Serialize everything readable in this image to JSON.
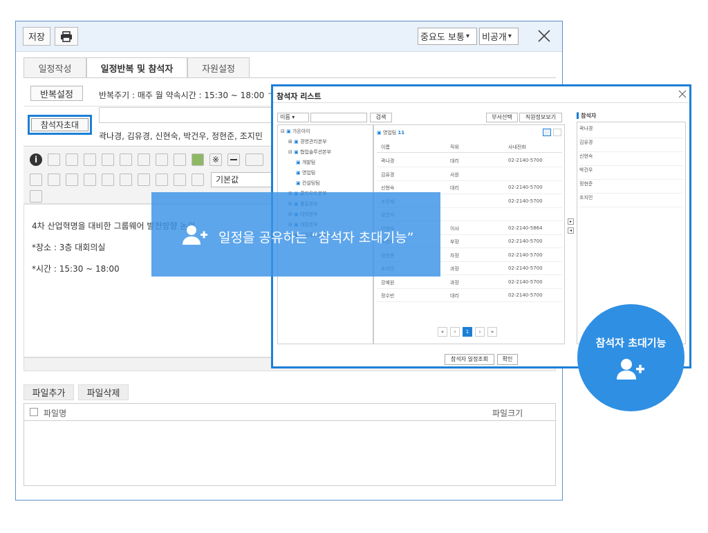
{
  "toolbar": {
    "save_label": "저장",
    "importance": "중요도 보통",
    "visibility": "비공개"
  },
  "tabs": [
    {
      "label": "일정작성"
    },
    {
      "label": "일정반복 및 참석자"
    },
    {
      "label": "자원설정"
    }
  ],
  "repeat": {
    "button": "반복설정",
    "text": "반복주기 : 매주 월 약속시간 : 15:30 ~ 18:00 ㄱ"
  },
  "invite": {
    "button": "참석자초대",
    "names": "곽나경, 김유경, 신현숙, 박건우, 정현준, 조지민"
  },
  "editor": {
    "font_select": "기본값",
    "lines": [
      "4차 산업혁명을 대비한 그룹웨어 발전방향 논의",
      "*장소 : 3층 대회의실",
      "*시간 : 15:30 ~ 18:00"
    ]
  },
  "files": {
    "add_button": "파일추가",
    "delete_button": "파일삭제",
    "col_name": "파일명",
    "col_size": "파일크기"
  },
  "modal": {
    "title": "참석자 리스트",
    "search_select": "이름",
    "search_button": "검색",
    "dept_select_button": "부서선택",
    "member_info_button": "직원정보보기",
    "tree": [
      {
        "label": "가온아이",
        "level": 0,
        "prefix": "⊟"
      },
      {
        "label": "경영관리본부",
        "level": 1,
        "prefix": "⊞"
      },
      {
        "label": "협업솔루션본부",
        "level": 1,
        "prefix": "⊟"
      },
      {
        "label": "개발팀",
        "level": 2,
        "prefix": ""
      },
      {
        "label": "영업팀",
        "level": 2,
        "prefix": ""
      },
      {
        "label": "컨설팅팀",
        "level": 2,
        "prefix": ""
      },
      {
        "label": "클라우드본부",
        "level": 1,
        "prefix": "⊞"
      },
      {
        "label": "품질본부",
        "level": 1,
        "prefix": "⊞"
      },
      {
        "label": "대학본부",
        "level": 1,
        "prefix": "⊞"
      },
      {
        "label": "개발본부",
        "level": 1,
        "prefix": "⊞"
      },
      {
        "label": "사업홍보본부",
        "level": 1,
        "prefix": "⊞"
      }
    ],
    "team_label": "영업팀",
    "team_count": "11",
    "columns": [
      "이름",
      "직위",
      "사내전화"
    ],
    "rows": [
      {
        "name": "곽나경",
        "position": "대리",
        "phone": "02-2140-5700"
      },
      {
        "name": "김유경",
        "position": "사원",
        "phone": ""
      },
      {
        "name": "신현숙",
        "position": "대리",
        "phone": "02-2140-5700"
      },
      {
        "name": "조민재",
        "position": "",
        "phone": "02-2140-5700"
      },
      {
        "name": "황인석",
        "position": "",
        "phone": ""
      },
      {
        "name": "이현숙",
        "position": "이사",
        "phone": "02-2140-5864"
      },
      {
        "name": "박건우",
        "position": "부장",
        "phone": "02-2140-5700"
      },
      {
        "name": "정현준",
        "position": "차장",
        "phone": "02-2140-5700"
      },
      {
        "name": "조지민",
        "position": "과장",
        "phone": "02-2140-5700"
      },
      {
        "name": "강예원",
        "position": "과장",
        "phone": "02-2140-5700"
      },
      {
        "name": "정수빈",
        "position": "대리",
        "phone": "02-2140-5700"
      }
    ],
    "pagination": [
      "«",
      "‹",
      "1",
      "›",
      "»"
    ],
    "participants_title": "참석자",
    "participants": [
      "곽나경",
      "김유경",
      "신현숙",
      "박건우",
      "정현준",
      "조지민"
    ],
    "schedule_button": "참석자 일정조회",
    "confirm_button": "확인"
  },
  "overlay": {
    "text": "일정을 공유하는 “참석자 초대기능”"
  },
  "badge": {
    "text": "참석자 초대기능"
  },
  "colors": {
    "accent": "#1c7fd6",
    "overlay": "#3a92e6",
    "badge": "#2f8fe3"
  }
}
